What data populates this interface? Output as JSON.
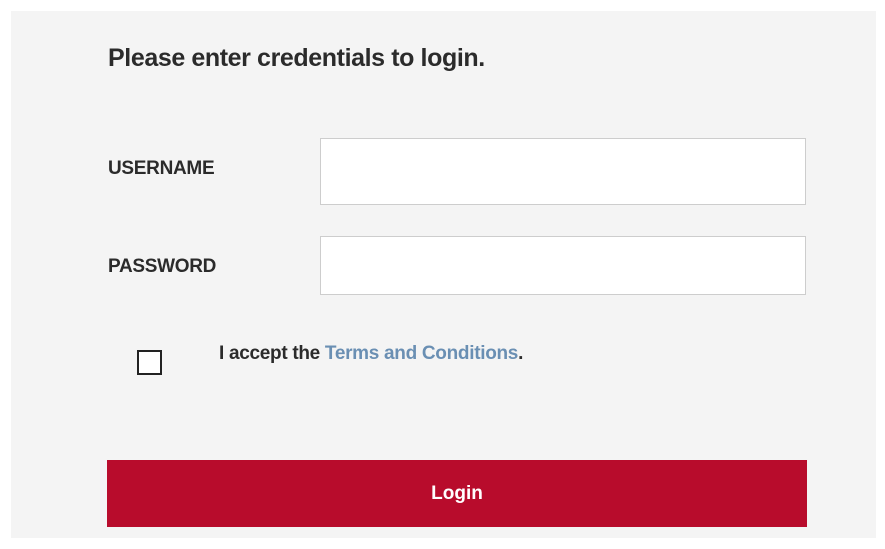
{
  "form": {
    "heading": "Please enter credentials to login.",
    "username": {
      "label": "USERNAME",
      "value": "",
      "placeholder": ""
    },
    "password": {
      "label": "PASSWORD",
      "value": "",
      "placeholder": ""
    },
    "terms": {
      "checked": false,
      "prefix": "I accept the ",
      "link_text": "Terms and Conditions",
      "suffix": "."
    },
    "login_button": {
      "label": "Login"
    }
  },
  "colors": {
    "panel_background": "#f4f4f4",
    "button_background": "#b80c2c",
    "link": "#6a8fb3",
    "text": "#2b2b2b"
  }
}
